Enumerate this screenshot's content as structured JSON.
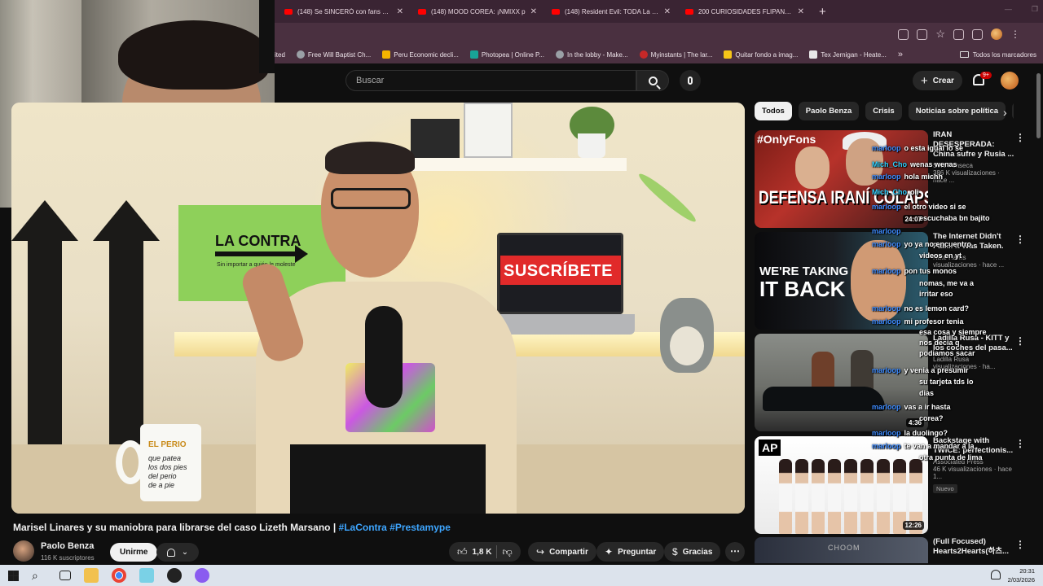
{
  "browser": {
    "tabs": [
      {
        "label": "(148) Se SINCERÓ con fans y fu"
      },
      {
        "label": "(148) MOOD COREA: ¡NMIXX p"
      },
      {
        "label": "(148) Resident Evil: TODA La Sa"
      },
      {
        "label": "200 CURIOSIDADES FLIPANTES"
      }
    ],
    "new_tab": "+",
    "bookmarks": [
      {
        "label": "ited",
        "color": "#4a3040"
      },
      {
        "label": "Free Will Baptist Ch...",
        "color": "#9aa0a6"
      },
      {
        "label": "Peru Economic decli...",
        "color": "#f4b400"
      },
      {
        "label": "Photopea | Online P...",
        "color": "#18a497"
      },
      {
        "label": "In the lobby - Make...",
        "color": "#9aa0a6"
      },
      {
        "label": "Myinstants | The lar...",
        "color": "#c62828"
      },
      {
        "label": "Quitar fondo a imag...",
        "color": "#f5c518"
      },
      {
        "label": "Tex Jernigan - Heate...",
        "color": "#e8e8e8"
      }
    ],
    "bookmarks_more": "»",
    "all_bookmarks": "Todos los marcadores"
  },
  "youtube": {
    "search_placeholder": "Buscar",
    "create_label": "Crear",
    "notifications_badge": "9+",
    "chips": [
      "Todos",
      "Paolo Benza",
      "Crisis",
      "Noticias sobre política",
      "E"
    ],
    "video": {
      "title_main": "Marisel Linares y su maniobra para librarse del caso Lizeth Marsano | ",
      "title_tags": "#LaContra #Prestamype",
      "overlay_green": "LA CONTRA",
      "overlay_green_sub": "Sin importar a quién le moleste",
      "overlay_subscribe": "SUSCRÍBETE",
      "mug_label": "EL PERIO",
      "mug_lines": [
        "que patea",
        "los dos pies",
        "del perio",
        "de a pie"
      ],
      "channel_name": "Paolo Benza",
      "channel_subs": "116 K suscriptores",
      "join_label": "Unirme",
      "likes": "1,8 K",
      "share_label": "Compartir",
      "ask_label": "Preguntar",
      "thanks_label": "Gracias"
    },
    "recommendations": [
      {
        "title": "IRAN DESESPERADA: China sufre y Rusia ...",
        "channel": "Solo Fonseca",
        "views": "386 K visualizaciones · hace ...",
        "duration": "24:07",
        "thumb_title": "#OnlyFons",
        "thumb_text": "DEFENSA IRANÍ COLAPSADA",
        "badge": ""
      },
      {
        "title": "The Internet Didn't Fail... It Was Taken.",
        "channel": "Nate Harris",
        "views": "visualizaciones · hace ...",
        "duration": "",
        "thumb_text_small": "WE'RE TAKING",
        "thumb_text_big": "IT BACK",
        "badge": ""
      },
      {
        "title": "Ladilla Rusa - KITT y los coches del pasa...",
        "channel": "Ladilla Rusa",
        "views": "visualizaciones · ha...",
        "duration": "4:36",
        "badge": ""
      },
      {
        "title": "Backstage with TWICE: perfectionis...",
        "channel": "Associated Press",
        "views": "46 K visualizaciones · hace 1...",
        "duration": "12:26",
        "thumb_logo": "AP",
        "badge": "Nuevo"
      },
      {
        "title": "(Full Focused) Hearts2Hearts(하츠...",
        "channel": "",
        "views": "",
        "duration": "",
        "thumb_label": "CHOOM",
        "badge": ""
      }
    ]
  },
  "chat": [
    {
      "user": "marloop",
      "text": "o esta igual lo se"
    },
    {
      "user": "Mich_Cho",
      "text": "wenas wenas"
    },
    {
      "user": "marloop",
      "text": "hola michh"
    },
    {
      "user": "Mich_Cho",
      "text": "oli"
    },
    {
      "user": "marloop",
      "text": "el otro video si se"
    },
    {
      "user": "",
      "text": "escuchaba bn bajito"
    },
    {
      "user": "marloop",
      "text": ""
    },
    {
      "user": "marloop",
      "text": "yo ya no encuentro"
    },
    {
      "user": "",
      "text": "videos en yt"
    },
    {
      "user": "marloop",
      "text": "pon tus monos"
    },
    {
      "user": "",
      "text": "nomas, me va a"
    },
    {
      "user": "",
      "text": "irritar eso"
    },
    {
      "user": "marloop",
      "text": "no es lemon card?"
    },
    {
      "user": "marloop",
      "text": "mi profesor tenia"
    },
    {
      "user": "",
      "text": "esa cosa y siempre"
    },
    {
      "user": "",
      "text": "nos decia q"
    },
    {
      "user": "",
      "text": "podiamos sacar"
    },
    {
      "user": "marloop",
      "text": "y venia a presumir"
    },
    {
      "user": "",
      "text": "su tarjeta tds lo"
    },
    {
      "user": "",
      "text": "dias"
    },
    {
      "user": "marloop",
      "text": "vas a ir hasta"
    },
    {
      "user": "",
      "text": "corea?"
    },
    {
      "user": "marloop",
      "text": "la duolingo?"
    },
    {
      "user": "marloop",
      "text": "te van a mandar a la"
    },
    {
      "user": "",
      "text": "otra punta de lima"
    }
  ],
  "taskbar": {
    "time": "20:31",
    "date": "2/03/2026"
  }
}
